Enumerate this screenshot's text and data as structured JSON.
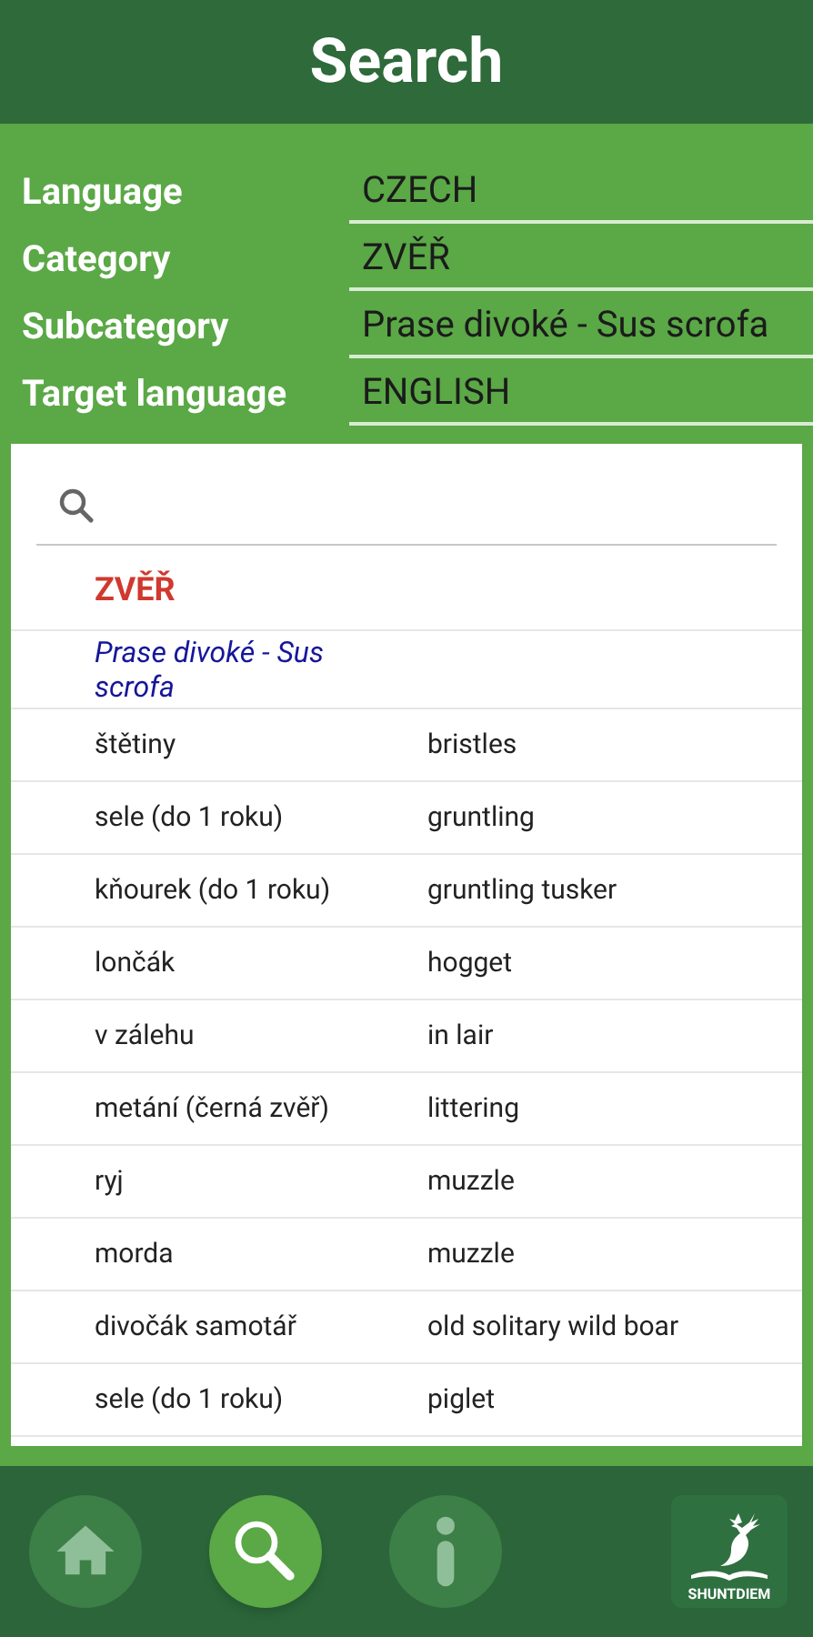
{
  "header": {
    "title": "Search"
  },
  "filters": [
    {
      "label": "Language",
      "value": "CZECH"
    },
    {
      "label": "Category",
      "value": "ZVĚŘ"
    },
    {
      "label": "Subcategory",
      "value": "Prase divoké - Sus scrofa"
    },
    {
      "label": "Target language",
      "value": "ENGLISH"
    }
  ],
  "results": {
    "category": "ZVĚŘ",
    "subcategory": "Prase divoké - Sus scrofa",
    "rows": [
      {
        "source": "štětiny",
        "target": "bristles"
      },
      {
        "source": "sele (do 1 roku)",
        "target": "gruntling"
      },
      {
        "source": "kňourek (do 1 roku)",
        "target": "gruntling tusker"
      },
      {
        "source": "lončák",
        "target": "hogget"
      },
      {
        "source": "v zálehu",
        "target": "in lair"
      },
      {
        "source": "metání (černá zvěř)",
        "target": "littering"
      },
      {
        "source": "ryj",
        "target": "muzzle"
      },
      {
        "source": "morda",
        "target": "muzzle"
      },
      {
        "source": "divočák samotář",
        "target": "old solitary wild boar"
      },
      {
        "source": "sele (do 1 roku)",
        "target": "piglet"
      }
    ]
  },
  "nav": [
    {
      "kind": "home",
      "selected": false
    },
    {
      "kind": "search",
      "selected": true
    },
    {
      "kind": "info",
      "selected": false
    }
  ],
  "logo": {
    "text": "SHUNTDIEM"
  }
}
